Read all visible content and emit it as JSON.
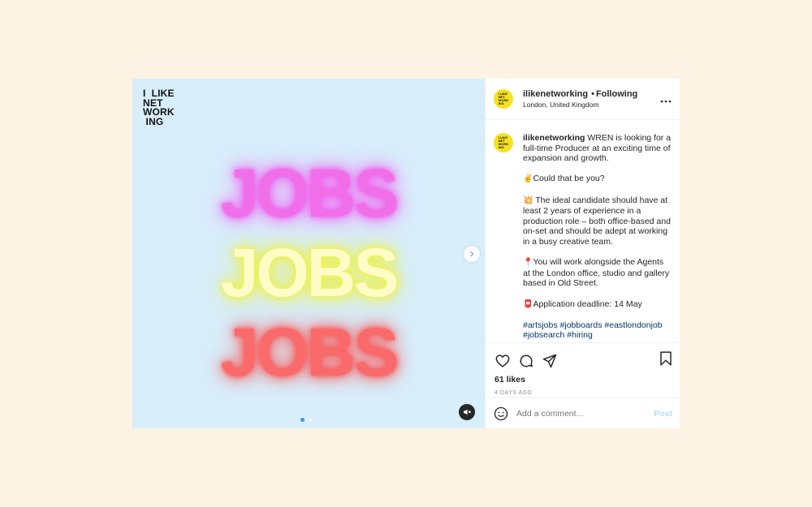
{
  "media": {
    "logo_lines": [
      "I  LIKE",
      "NET",
      "WORK",
      " ING"
    ],
    "jobs_words": [
      "JOBS",
      "JOBS",
      "JOBS"
    ],
    "colors": {
      "background": "#d8eefb",
      "pink": "#f06fe8",
      "yellow": "#fffcc8",
      "red": "#fa6a6a"
    },
    "carousel_index": 1,
    "carousel_count": 2,
    "next_icon": "chevron-right-icon",
    "mute_icon": "muted-speaker-icon"
  },
  "header": {
    "username": "ilikenetworking",
    "separator": "•",
    "follow_status": "Following",
    "location": "London, United Kingdom",
    "more_icon": "more-options-icon"
  },
  "caption": {
    "username": "ilikenetworking",
    "intro": "WREN is looking for a full-time Producer at an exciting time of expansion and growth.",
    "question": "Could that be you?",
    "question_emoji": "✌",
    "requirements": "The ideal candidate should have at least 2 years of experience in a production role – both office-based and on-set and should be adept at working in a busy creative team.",
    "requirements_emoji": "💥",
    "location_info": "You will work alongside the Agents at the London office, studio and gallery based in Old Street.",
    "location_emoji": "📍",
    "deadline": "Application deadline: 14 May",
    "deadline_emoji": "📮",
    "hashtags": "#artsjobs #jobboards #eastlondonjob #jobsearch #hiring"
  },
  "actions": {
    "icons": [
      "heart-icon",
      "comment-icon",
      "share-icon",
      "bookmark-icon"
    ],
    "likes": "61 likes",
    "timestamp": "4 DAYS AGO"
  },
  "comment": {
    "placeholder": "Add a comment...",
    "post_label": "Post",
    "emoji_icon": "smiley-icon"
  }
}
